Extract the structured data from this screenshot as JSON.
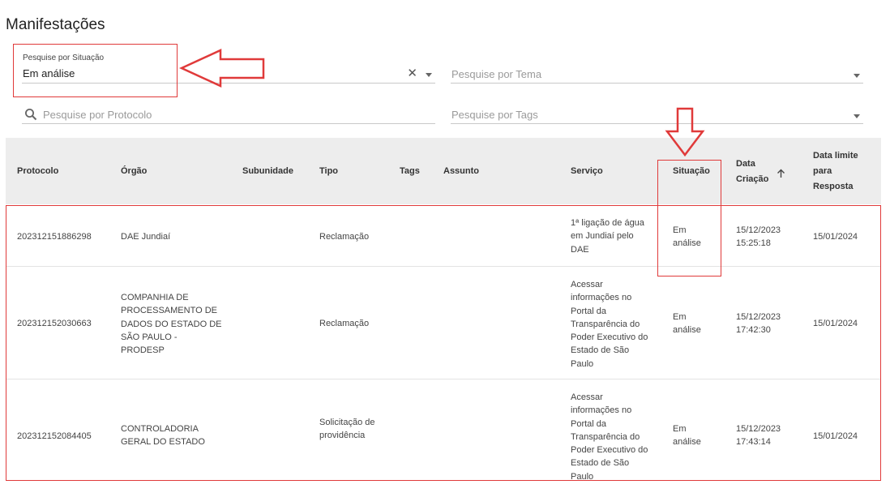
{
  "page": {
    "title": "Manifestações"
  },
  "filters": {
    "situacao": {
      "label": "Pesquise por Situação",
      "value": "Em análise"
    },
    "tema": {
      "placeholder": "Pesquise por Tema"
    },
    "protocolo": {
      "placeholder": "Pesquise por Protocolo"
    },
    "tags": {
      "placeholder": "Pesquise por Tags"
    }
  },
  "table": {
    "headers": {
      "protocolo": "Protocolo",
      "orgao": "Órgão",
      "subunidade": "Subunidade",
      "tipo": "Tipo",
      "tags": "Tags",
      "assunto": "Assunto",
      "servico": "Serviço",
      "situacao": "Situação",
      "data_criacao": "Data Criação",
      "data_limite": "Data limite para Resposta"
    },
    "rows": [
      {
        "protocolo": "202312151886298",
        "orgao": "DAE Jundiaí",
        "subunidade": "",
        "tipo": "Reclamação",
        "tags": "",
        "assunto": "",
        "servico": "1ª ligação de água em Jundiaí pelo DAE",
        "situacao": "Em análise",
        "data_criacao": "15/12/2023 15:25:18",
        "data_limite": "15/01/2024"
      },
      {
        "protocolo": "202312152030663",
        "orgao": "COMPANHIA DE PROCESSAMENTO DE DADOS DO ESTADO DE SÃO PAULO - PRODESP",
        "subunidade": "",
        "tipo": "Reclamação",
        "tags": "",
        "assunto": "",
        "servico": "Acessar informações no Portal da Transparência do Poder Executivo do Estado de São Paulo",
        "situacao": "Em análise",
        "data_criacao": "15/12/2023 17:42:30",
        "data_limite": "15/01/2024"
      },
      {
        "protocolo": "202312152084405",
        "orgao": "CONTROLADORIA GERAL DO ESTADO",
        "subunidade": "",
        "tipo": "Solicitação de providência",
        "tags": "",
        "assunto": "",
        "servico": "Acessar informações no Portal da Transparência do Poder Executivo do Estado de São Paulo",
        "situacao": "Em análise",
        "data_criacao": "15/12/2023 17:43:14",
        "data_limite": "15/01/2024"
      }
    ]
  },
  "colors": {
    "annotation": "#e03a3a",
    "header_bg": "#ededed"
  },
  "icons": {
    "search": "search-icon",
    "clear": "close-icon",
    "dropdown": "chevron-down-icon",
    "sort": "arrow-up-icon"
  }
}
